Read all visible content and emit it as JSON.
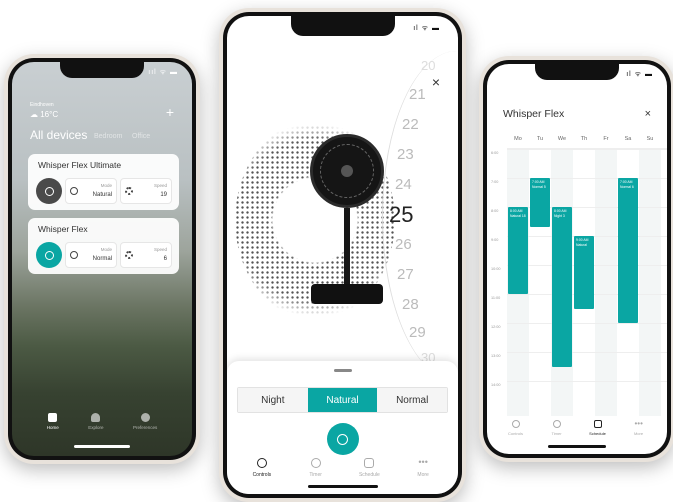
{
  "colors": {
    "accent": "#0aa6a3",
    "dark_tile": "#4a4a4a"
  },
  "home_screen": {
    "status_icons": "ııl ᯤ ▬",
    "location": "Eindhoven",
    "temperature": "16°C",
    "add_icon": "+",
    "heading": "All devices",
    "room_tabs": [
      "Bedroom",
      "Office"
    ],
    "devices": [
      {
        "name": "Whisper Flex Ultimate",
        "power": "off",
        "mode_label": "Mode",
        "mode_value": "Natural",
        "speed_label": "Speed",
        "speed_value": "19"
      },
      {
        "name": "Whisper Flex",
        "power": "on",
        "mode_label": "Mode",
        "mode_value": "Normal",
        "speed_label": "Speed",
        "speed_value": "6"
      }
    ],
    "nav": [
      {
        "label": "Home",
        "icon": "home-icon",
        "active": true
      },
      {
        "label": "Explore",
        "icon": "bulb-icon",
        "active": false
      },
      {
        "label": "Preferences",
        "icon": "user-icon",
        "active": false
      }
    ]
  },
  "control_screen": {
    "status_icons": "ıl ᯤ ▬",
    "close_icon": "×",
    "speed_numbers": [
      "20",
      "21",
      "22",
      "23",
      "24",
      "25",
      "26",
      "27",
      "28",
      "29",
      "30"
    ],
    "selected_speed": "25",
    "modes": [
      "Night",
      "Natural",
      "Normal"
    ],
    "selected_mode": "Natural",
    "nav": [
      {
        "label": "Controls",
        "icon": "toggle-icon",
        "active": true
      },
      {
        "label": "Timer",
        "icon": "timer-icon",
        "active": false
      },
      {
        "label": "Schedule",
        "icon": "calendar-icon",
        "active": false
      },
      {
        "label": "More",
        "icon": "more-icon",
        "active": false
      }
    ]
  },
  "schedule_screen": {
    "status_icons": "ıl ᯤ ▬",
    "title": "Whisper Flex",
    "close_icon": "×",
    "days": [
      "Mo",
      "Tu",
      "We",
      "Th",
      "Fr",
      "Sa",
      "Su"
    ],
    "times": [
      "6:00",
      "7:00",
      "8:00",
      "9:00",
      "10:00",
      "11:00",
      "12:00",
      "13:00",
      "14:00"
    ],
    "events": [
      {
        "day": 0,
        "start": 8.0,
        "end": 11.0,
        "label": "8:00 AM Natural 18"
      },
      {
        "day": 1,
        "start": 7.0,
        "end": 8.7,
        "label": "7:00 AM Normal 5"
      },
      {
        "day": 2,
        "start": 8.0,
        "end": 13.5,
        "label": "8:00 AM Night 3"
      },
      {
        "day": 3,
        "start": 9.0,
        "end": 11.5,
        "label": "9:00 AM Natural"
      },
      {
        "day": 5,
        "start": 7.0,
        "end": 12.0,
        "label": "7:00 AM Normal 6"
      }
    ],
    "nav": [
      {
        "label": "Controls",
        "icon": "toggle-icon",
        "active": false
      },
      {
        "label": "Timer",
        "icon": "timer-icon",
        "active": false
      },
      {
        "label": "Schedule",
        "icon": "calendar-icon",
        "active": true
      },
      {
        "label": "More",
        "icon": "more-icon",
        "active": false
      }
    ]
  }
}
